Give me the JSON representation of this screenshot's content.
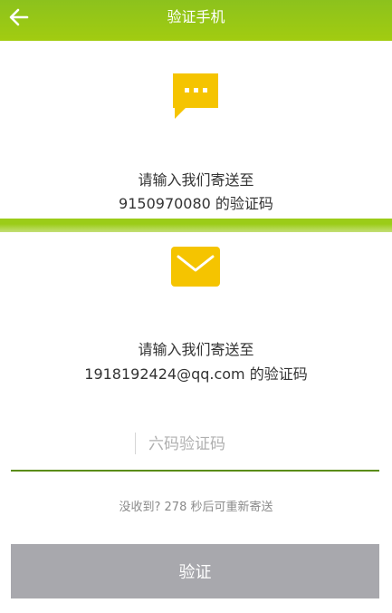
{
  "header": {
    "title": "验证手机",
    "back_icon": "arrow-left-icon",
    "background": "#9cc614",
    "text_color": "#ffffff"
  },
  "phone_section": {
    "icon": "chat-bubble-icon",
    "icon_color": "#f5c400",
    "line1": "请输入我们寄送至",
    "line2": "9150970080 的验证码"
  },
  "email_section": {
    "icon": "envelope-icon",
    "icon_color": "#f5c400",
    "line1": "请输入我们寄送至",
    "line2": "1918192424@qq.com 的验证码"
  },
  "code_input": {
    "value": "",
    "placeholder": "六码验证码"
  },
  "resend_hint": "没收到? 278 秒后可重新寄送",
  "verify_button": {
    "label": "验证",
    "background": "#a8a8ad",
    "text_color": "#ffffff"
  },
  "accent_color": "#9bcc18"
}
